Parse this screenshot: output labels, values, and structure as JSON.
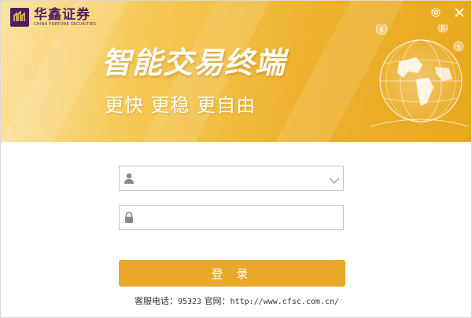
{
  "brand": {
    "name_cn": "华鑫证券",
    "name_en": "CHINA FORTUNE SECURITIES",
    "color": "#4b1e63"
  },
  "banner": {
    "headline": "智能交易终端",
    "tagline": "更快 更稳 更自由",
    "gradient_colors": [
      "#fbe3a3",
      "#f6c955",
      "#eeb22d",
      "#e8a81f"
    ]
  },
  "window_controls": {
    "settings_icon": "gear-icon",
    "close_icon": "close-icon"
  },
  "login_form": {
    "username": {
      "value": "",
      "placeholder": "",
      "icon": "user-icon",
      "has_dropdown": true
    },
    "password": {
      "value": "",
      "placeholder": "",
      "icon": "lock-icon"
    },
    "login_label": "登 录",
    "button_color": "#e8a928"
  },
  "footer": {
    "hotline_label": "客服电话：",
    "hotline": "95323",
    "website_label": "官网：",
    "website": "http://www.cfsc.com.cn/"
  }
}
